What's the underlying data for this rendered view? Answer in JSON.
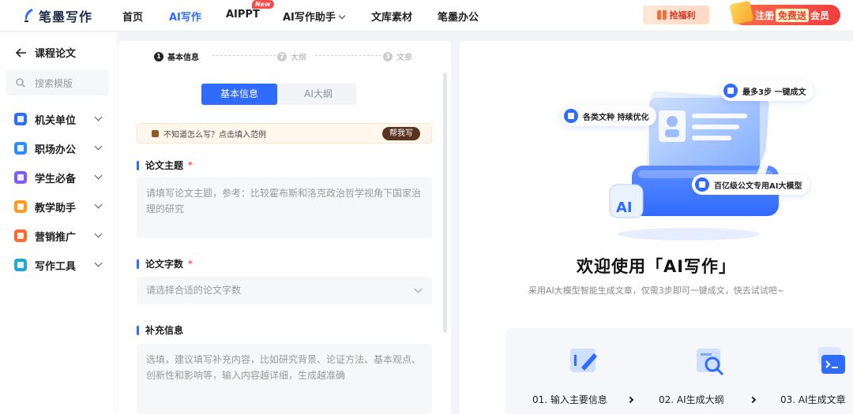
{
  "header": {
    "logo_text": "笔墨写作",
    "nav": [
      {
        "label": "首页"
      },
      {
        "label": "AI写作"
      },
      {
        "label": "AIPPT",
        "badge": "New"
      },
      {
        "label": "AI写作助手"
      },
      {
        "label": "文库素材"
      },
      {
        "label": "笔墨办公"
      }
    ],
    "promo_label": "抢福利",
    "register_label_1": "注册",
    "register_free": "免费送",
    "register_label_2": "会员"
  },
  "sidebar": {
    "back_label": "课程论文",
    "search_placeholder": "搜索模版",
    "items": [
      {
        "label": "机关单位",
        "icon": "building-icon",
        "color": "#2f6bff"
      },
      {
        "label": "职场办公",
        "icon": "briefcase-icon",
        "color": "#2f8cff"
      },
      {
        "label": "学生必备",
        "icon": "book-icon",
        "color": "#7b5cff"
      },
      {
        "label": "教学助手",
        "icon": "teacher-icon",
        "color": "#ff9a1f"
      },
      {
        "label": "营销推广",
        "icon": "megaphone-icon",
        "color": "#ff6a2b"
      },
      {
        "label": "写作工具",
        "icon": "toolbox-icon",
        "color": "#23a6d5"
      }
    ]
  },
  "form": {
    "steps": [
      {
        "num": "1",
        "label": "基本信息"
      },
      {
        "num": "2",
        "label": "大纲"
      },
      {
        "num": "3",
        "label": "文章"
      }
    ],
    "tabs": [
      "基本信息",
      "AI大纲"
    ],
    "hint_text": "不知道怎么写？点击填入范例",
    "help_label": "帮我写",
    "topic_label": "论文主题",
    "topic_required": "*",
    "topic_placeholder": "请填写论文主题，参考：比较霍布斯和洛克政治哲学视角下国家治理的研究",
    "words_label": "论文字数",
    "words_required": "*",
    "words_placeholder": "请选择合适的论文字数",
    "extra_label": "补充信息",
    "extra_placeholder": "选填，建议填写补充内容，比如研究背景、论证方法、基本观点、创新性和影响等，输入内容越详细，生成越准确"
  },
  "intro": {
    "tag_1": "最多3步 一键成文",
    "tag_2": "各类文种 持续优化",
    "tag_3": "百亿级公文专用AI大模型",
    "illus_ai": "AI",
    "title": "欢迎使用「AI写作」",
    "subtitle": "采用AI大模型智能生成文章，仅需3步即可一键成文，快去试试吧~",
    "features": [
      {
        "label": "01. 输入主要信息",
        "icon": "edit-doc-icon"
      },
      {
        "label": "02. AI生成大纲",
        "icon": "search-doc-icon"
      },
      {
        "label": "03. AI生成文章",
        "icon": "terminal-doc-icon"
      }
    ]
  },
  "colors": {
    "accent": "#2f6bff",
    "required": "#ff4d4f",
    "register": "#f23d3d"
  }
}
